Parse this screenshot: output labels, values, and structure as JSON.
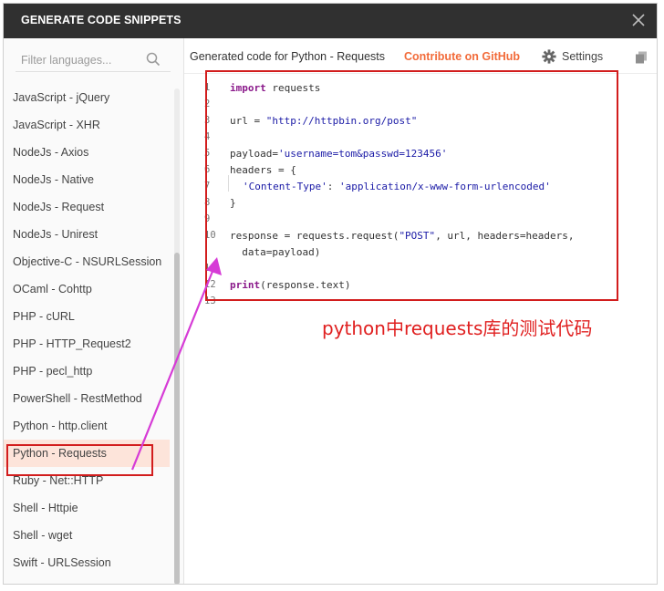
{
  "modal": {
    "title": "GENERATE CODE SNIPPETS"
  },
  "search": {
    "placeholder": "Filter languages..."
  },
  "sidebar": {
    "items": [
      "JavaScript - jQuery",
      "JavaScript - XHR",
      "NodeJs - Axios",
      "NodeJs - Native",
      "NodeJs - Request",
      "NodeJs - Unirest",
      "Objective-C - NSURLSession",
      "OCaml - Cohttp",
      "PHP - cURL",
      "PHP - HTTP_Request2",
      "PHP - pecl_http",
      "PowerShell - RestMethod",
      "Python - http.client",
      "Python - Requests",
      "Ruby - Net::HTTP",
      "Shell - Httpie",
      "Shell - wget",
      "Swift - URLSession"
    ],
    "selected": "Python - Requests"
  },
  "toolbar": {
    "generated_label": "Generated code for Python - Requests",
    "github_label": "Contribute on GitHub",
    "settings_label": "Settings"
  },
  "code": {
    "line_numbers": [
      "1",
      "2",
      "3",
      "4",
      "5",
      "6",
      "7",
      "8",
      "9",
      "10",
      "",
      "11",
      "12",
      "13"
    ],
    "l1_kw": "import",
    "l1_rest": " requests",
    "l3_pre": "url = ",
    "l3_str": "\"http://httpbin.org/post\"",
    "l5_pre": "payload=",
    "l5_str": "'username=tom&passwd=123456'",
    "l6": "headers = {",
    "l7_key": "'Content-Type'",
    "l7_colon": ": ",
    "l7_val": "'application/x-www-form-urlencoded'",
    "l8": "}",
    "l10_pre": "response = requests.request(",
    "l10_str": "\"POST\"",
    "l10_post": ", url, headers=headers,",
    "l10b": "  data=payload)",
    "l12_kw": "print",
    "l12_rest": "(response.text)"
  },
  "annotation": {
    "text": "python中requests库的测试代码"
  },
  "colors": {
    "titlebar": "#303030",
    "accent": "#f26b3a",
    "highlight": "#d21d1d",
    "arrow": "#d63bd6",
    "selected_bg": "#fde4da"
  }
}
